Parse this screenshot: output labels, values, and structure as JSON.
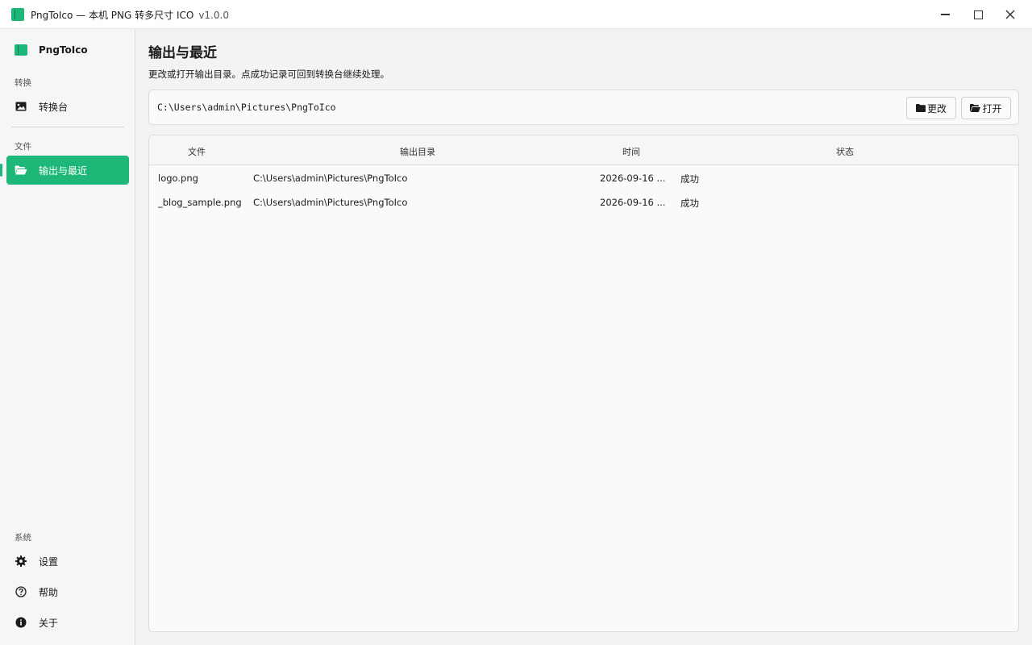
{
  "window": {
    "title": "PngToIco — 本机 PNG 转多尺寸 ICO",
    "version": "v1.0.0"
  },
  "sidebar": {
    "brand": "PngToIco",
    "sections": {
      "convert": "转换",
      "files": "文件",
      "system": "系统"
    },
    "items": {
      "workbench": "转换台",
      "output_recent": "输出与最近",
      "settings": "设置",
      "help": "帮助",
      "about": "关于"
    },
    "active": "output_recent"
  },
  "main": {
    "title": "输出与最近",
    "description": "更改或打开输出目录。点成功记录可回到转换台继续处理。",
    "output_path": "C:\\Users\\admin\\Pictures\\PngToIco",
    "change_button": "更改",
    "open_button": "打开"
  },
  "table": {
    "columns": [
      "文件",
      "输出目录",
      "时间",
      "状态"
    ],
    "rows": [
      [
        "logo.png",
        "C:\\Users\\admin\\Pictures\\PngToIco",
        "2026-09-16 ...",
        "成功"
      ],
      [
        "_blog_sample.png",
        "C:\\Users\\admin\\Pictures\\PngToIco",
        "2026-09-16 ...",
        "成功"
      ]
    ]
  },
  "colors": {
    "accent": "#1db877"
  },
  "icons": {
    "image": "image-icon",
    "folder_open": "folder-open-icon",
    "gear": "gear-icon",
    "help": "help-circle-icon",
    "info": "info-icon",
    "folder": "folder-icon"
  }
}
